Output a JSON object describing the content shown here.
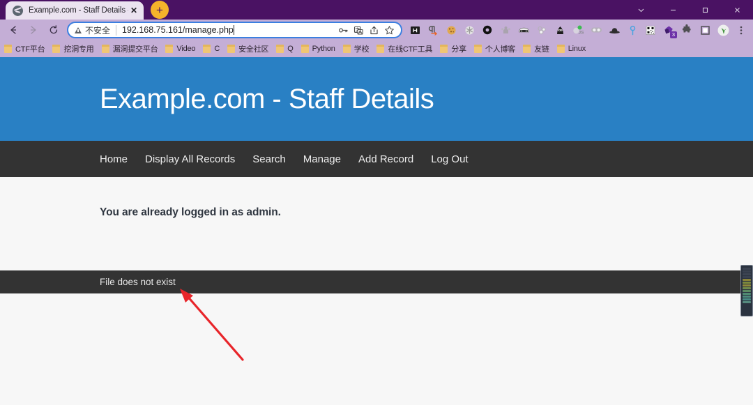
{
  "browser": {
    "tab": {
      "title": "Example.com - Staff Details - \\",
      "favicon_name": "globe-icon",
      "close_label": "✕"
    },
    "new_tab_label": "+",
    "window_controls": [
      {
        "name": "tab-search-chevron",
        "label": "⌄"
      },
      {
        "name": "minimize",
        "label": "–"
      },
      {
        "name": "maximize",
        "label": "❐"
      },
      {
        "name": "close",
        "label": "✕"
      }
    ],
    "nav": {
      "back_label": "←",
      "forward_label": "→",
      "reload_label": "⟳"
    },
    "omnibox": {
      "security_label": "不安全",
      "url": "192.168.75.161/manage.php",
      "icons": [
        {
          "name": "password-key-icon",
          "label": "⚷"
        },
        {
          "name": "translate-icon",
          "label": "文"
        },
        {
          "name": "share-icon",
          "label": "↱"
        },
        {
          "name": "bookmark-star-icon",
          "label": "☆"
        }
      ]
    },
    "extensions": [
      {
        "name": "hackbar-extension-icon",
        "label": "H"
      },
      {
        "name": "pilcrow-extension-icon",
        "label": "¶"
      },
      {
        "name": "cookie-editor-extension-icon",
        "label": "●"
      },
      {
        "name": "snowflake-extension-icon",
        "label": "❅"
      },
      {
        "name": "ring-extension-icon",
        "label": "⬤"
      },
      {
        "name": "people-extension-icon",
        "label": "⛹"
      },
      {
        "name": "masked-car-extension-icon",
        "label": "▰"
      },
      {
        "name": "bubbles-extension-icon",
        "label": "○"
      },
      {
        "name": "ninja-extension-icon",
        "label": "♟"
      },
      {
        "name": "javascript-extension-icon",
        "label": "JS"
      },
      {
        "name": "goggles-extension-icon",
        "label": "◑"
      },
      {
        "name": "hat-extension-icon",
        "label": "⌒"
      },
      {
        "name": "pin-extension-icon",
        "label": "⚲"
      },
      {
        "name": "qrcode-extension-icon",
        "label": "░"
      },
      {
        "name": "shapes-extension-icon",
        "label": "⬟",
        "badge": "3"
      },
      {
        "name": "puzzle-extensions-icon",
        "label": "❖"
      },
      {
        "name": "square-extension-icon",
        "label": "□"
      },
      {
        "name": "profile-avatar-icon",
        "label": "❦"
      },
      {
        "name": "chrome-menu-icon",
        "label": "⋮"
      }
    ],
    "bookmarks": [
      "CTF平台",
      "挖洞专用",
      "漏洞提交平台",
      "Video",
      "C",
      "安全社区",
      "Q",
      "Python",
      "学校",
      "在线CTF工具",
      "分享",
      "个人博客",
      "友链",
      "Linux"
    ]
  },
  "page": {
    "header_title": "Example.com - Staff Details",
    "nav_links": [
      "Home",
      "Display All Records",
      "Search",
      "Manage",
      "Add Record",
      "Log Out"
    ],
    "login_message": "You are already logged in as admin.",
    "footer_message": "File does not exist",
    "colors": {
      "header_blue": "#2980c4",
      "nav_dark": "#333333",
      "page_bg": "#f7f7f7",
      "annotation_red": "#e8252a"
    }
  }
}
